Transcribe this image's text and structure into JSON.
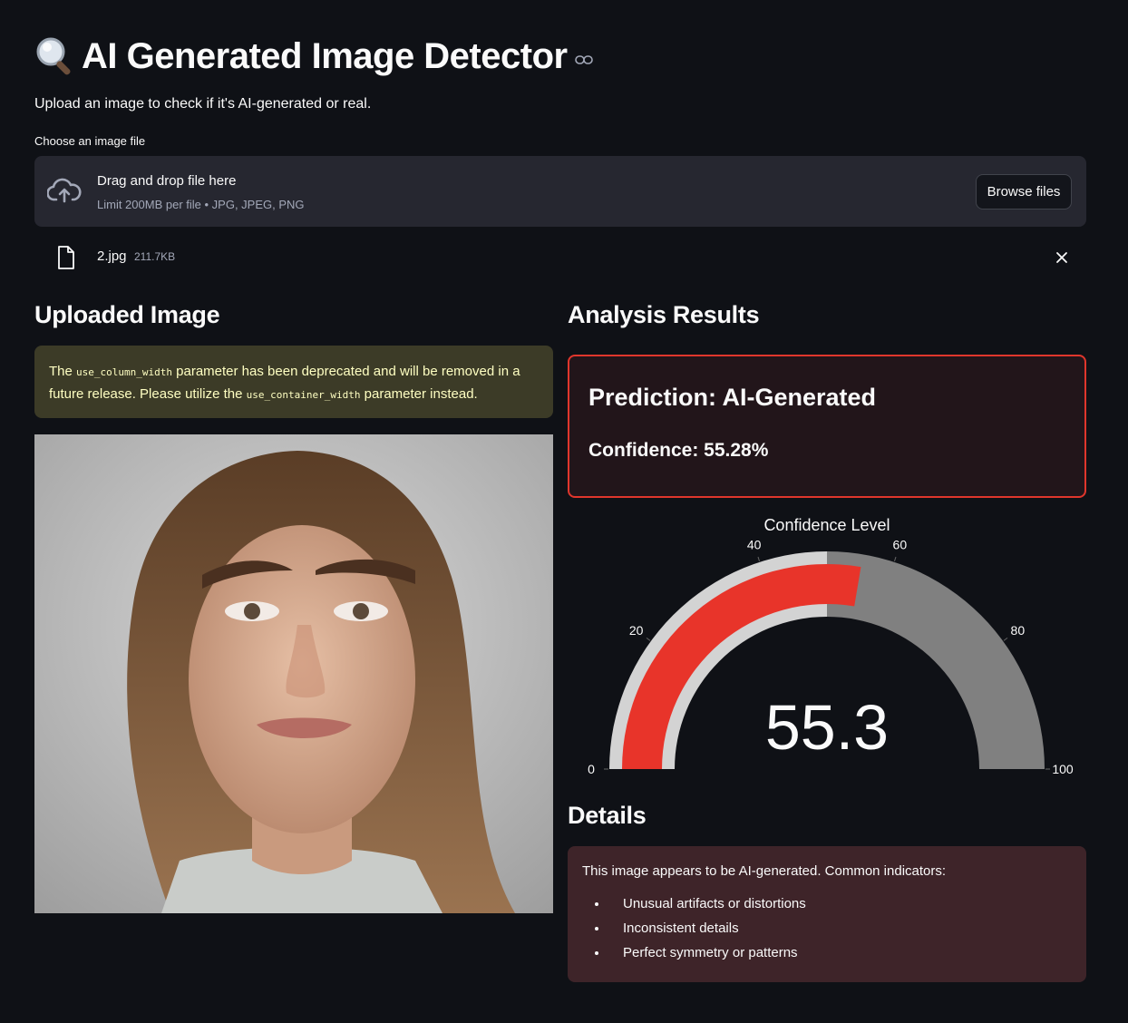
{
  "header": {
    "title": "AI Generated Image Detector",
    "subtitle": "Upload an image to check if it's AI-generated or real."
  },
  "uploader": {
    "label": "Choose an image file",
    "dropzone_title": "Drag and drop file here",
    "limit_text": "Limit 200MB per file • JPG, JPEG, PNG",
    "browse_label": "Browse files",
    "file": {
      "name": "2.jpg",
      "size": "211.7KB"
    }
  },
  "left": {
    "heading": "Uploaded Image",
    "warning": {
      "part1": "The ",
      "code1": "use_column_width",
      "part2": " parameter has been deprecated and will be removed in a future release. Please utilize the ",
      "code2": "use_container_width",
      "part3": " parameter instead."
    }
  },
  "right": {
    "heading": "Analysis Results",
    "prediction": "Prediction: AI-Generated",
    "confidence": "Confidence: 55.28%",
    "details_heading": "Details",
    "details_intro": "This image appears to be AI-generated. Common indicators:",
    "details_items": [
      "Unusual artifacts or distortions",
      "Inconsistent details",
      "Perfect symmetry or patterns"
    ]
  },
  "chart_data": {
    "type": "gauge",
    "title": "Confidence Level",
    "value": 55.3,
    "value_label": "55.3",
    "range": [
      0,
      100
    ],
    "tick_labels": [
      "0",
      "20",
      "40",
      "60",
      "80",
      "100"
    ],
    "steps": [
      {
        "range": [
          0,
          50
        ],
        "color": "#d3d3d3"
      },
      {
        "range": [
          50,
          100
        ],
        "color": "#808080"
      }
    ],
    "bar_color": "#e8342a"
  }
}
